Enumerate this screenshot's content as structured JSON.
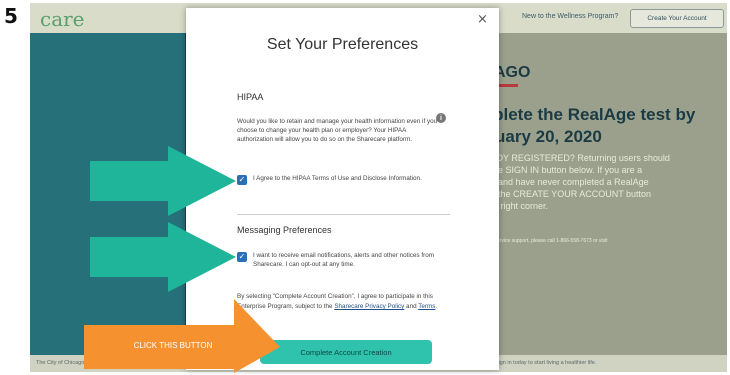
{
  "step_number": "5",
  "background": {
    "logo_text": "care",
    "top_right_question": "New to the Wellness Program?",
    "create_account_label": "Create Your Account",
    "city_title": "ICAGO",
    "realage_heading": "mplete the RealAge test by\nbruary 20, 2020",
    "already_registered": "READY REGISTERED? Returning users should\n on the SIGN IN button below. If you are a\nuser and have never completed a RealAge\n click the CREATE YOUR ACCOUNT button\ne top right corner.",
    "contact_text": "ember Service support, please call 1-866-558-7673 or visit",
    "bottom_left_text": "The City of Chicago | HCA | Sharecare",
    "bottom_right_text": "ed to sign in today to start living a healthier life."
  },
  "modal": {
    "close_glyph": "×",
    "title": "Set Your Preferences",
    "hipaa": {
      "heading": "HIPAA",
      "description": "Would you like to retain and manage your health information even if you choose to change your health plan or employer? Your HIPAA authorization will allow you to do so on the Sharecare platform.",
      "checkbox_label": "I Agree to the HIPAA Terms of Use and Disclose Information.",
      "checked": true
    },
    "messaging": {
      "heading": "Messaging Preferences",
      "checkbox_label": "I want to receive email notifications, alerts and other notices from Sharecare. I can opt-out at any time.",
      "checked": true
    },
    "legal": {
      "text_before": "By selecting \"Complete Account Creation\", I agree to participate in this Enterprise Program, subject to the ",
      "privacy_link": "Sharecare Privacy Policy",
      "text_and": " and ",
      "terms_link": "Terms",
      "text_end": "."
    },
    "complete_button_label": "Complete Account Creation"
  },
  "annotation": {
    "click_label": "CLICK THIS BUTTON",
    "arrow_color_teal": "#1fb59a",
    "arrow_color_orange": "#f5922f"
  }
}
